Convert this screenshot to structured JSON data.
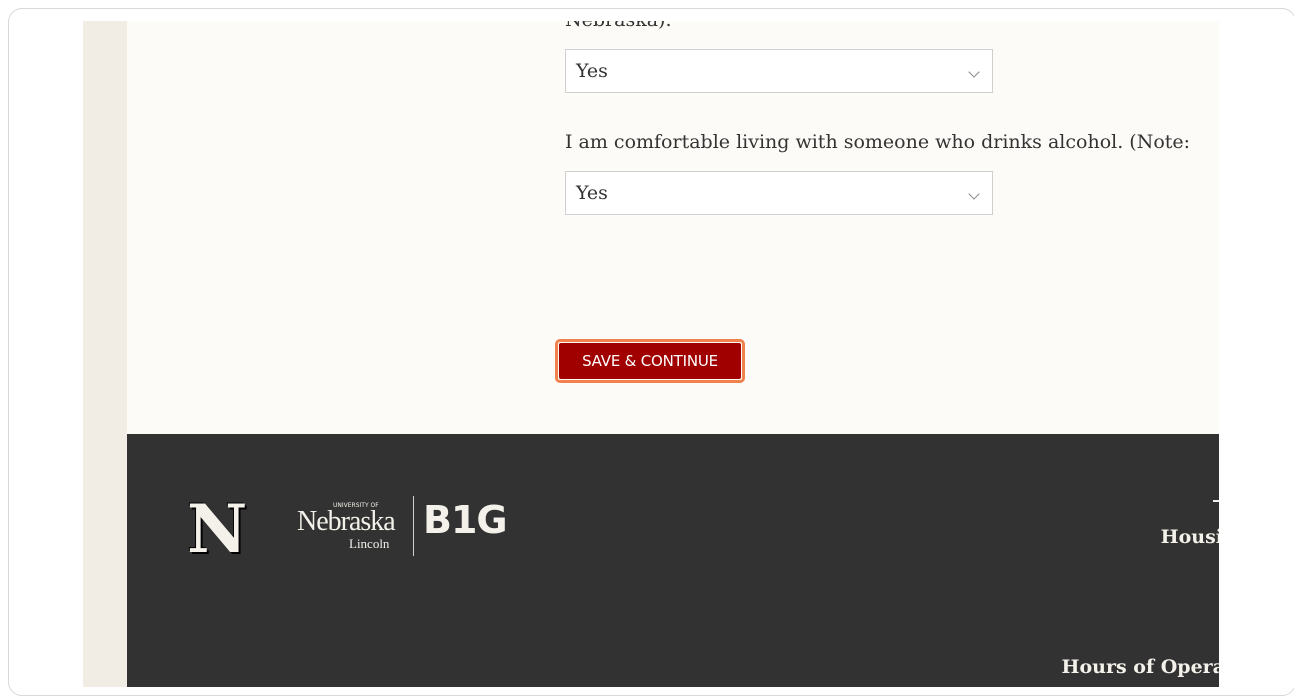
{
  "form": {
    "previous_question_fragment": "Nebraska).",
    "select1_value": "Yes",
    "question2": "I am comfortable living with someone who drinks alcohol. (Note:",
    "select2_value": "Yes",
    "save_button_label": "SAVE & CONTINUE"
  },
  "footer": {
    "logo_n": "N",
    "logo_university": "UNIVERSITY OF",
    "logo_nebraska": "Nebraska",
    "logo_lincoln": "Lincoln",
    "logo_big": "B1G",
    "housing_text": "Housi",
    "hours_text": "Hours of Opera"
  },
  "colors": {
    "accent": "#a00000",
    "focus_ring": "#f1824e",
    "footer_bg": "#323232",
    "page_bg": "#fdfbf8"
  }
}
